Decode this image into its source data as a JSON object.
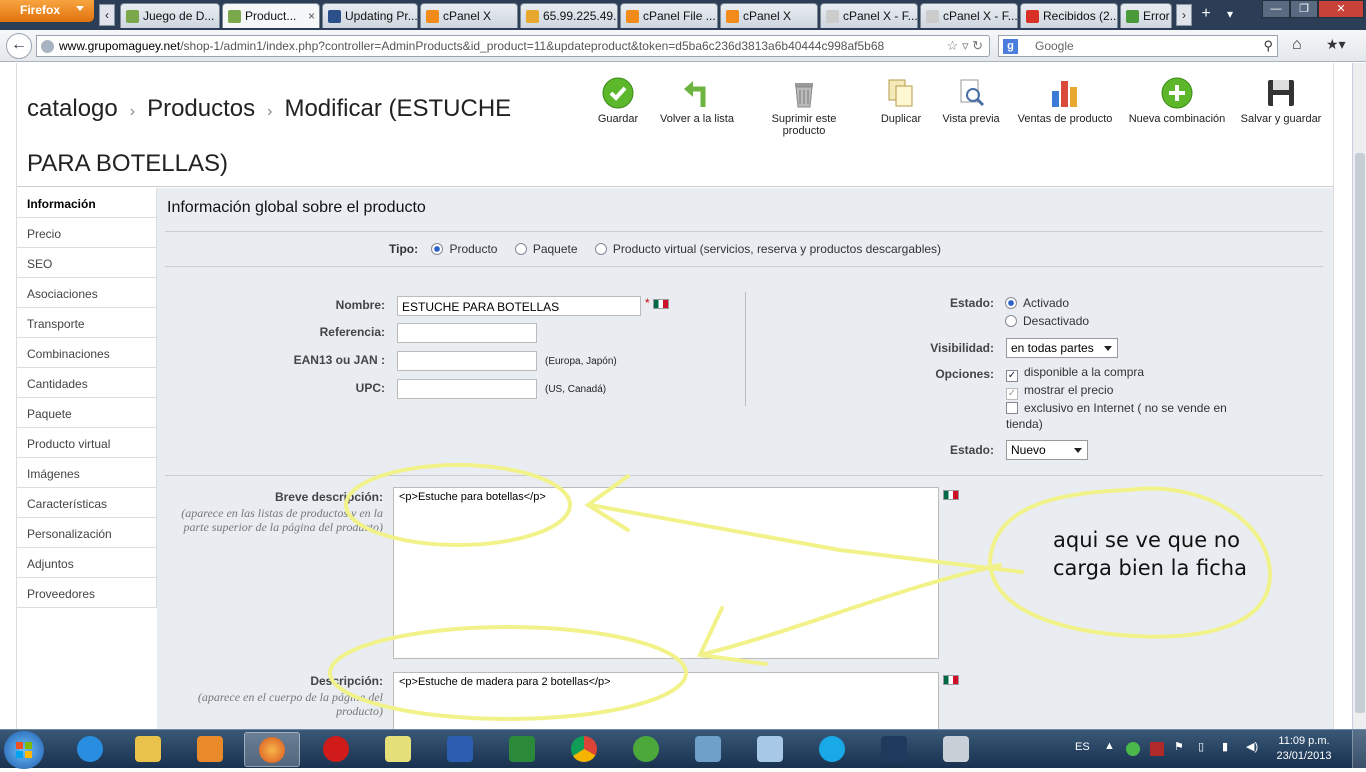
{
  "browser": {
    "app_button": "Firefox",
    "tabs": [
      {
        "label": "Juego de D...",
        "color": "#7aa84a",
        "active": false
      },
      {
        "label": "Product...",
        "color": "#7aa84a",
        "active": true,
        "close": "×"
      },
      {
        "label": "Updating Pr...",
        "color": "#2a4f8a",
        "active": false
      },
      {
        "label": "cPanel X",
        "color": "#f28b1a",
        "active": false
      },
      {
        "label": "65.99.225.49...",
        "color": "#e8a830",
        "active": false
      },
      {
        "label": "cPanel File ...",
        "color": "#f28b1a",
        "active": false
      },
      {
        "label": "cPanel X",
        "color": "#f28b1a",
        "active": false
      },
      {
        "label": "cPanel X - F...",
        "color": "#cccccc",
        "active": false
      },
      {
        "label": "cPanel X - F...",
        "color": "#cccccc",
        "active": false
      },
      {
        "label": "Recibidos (2...",
        "color": "#d93025",
        "active": false
      },
      {
        "label": "Error",
        "color": "#4a9a3a",
        "active": false
      }
    ],
    "url_host": "www.grupomaguey.net",
    "url_path": "/shop-1/admin1/index.php?controller=AdminProducts&id_product=11&updateproduct&token=d5ba6c236d3813a6b40444c998af5b68",
    "search_placeholder": "Google"
  },
  "breadcrumb": {
    "part1": "catalogo",
    "part2": "Productos",
    "part3": "Modificar (ESTUCHE PARA BOTELLAS)",
    "separator": "›"
  },
  "toolbar": {
    "save": "Guardar",
    "back": "Volver a la lista",
    "delete": "Suprimir este producto",
    "duplicate": "Duplicar",
    "preview": "Vista previa",
    "sales": "Ventas de producto",
    "new_combination": "Nueva combinación",
    "save_stay": "Salvar y guardar"
  },
  "sidebar": {
    "items": [
      "Información",
      "Precio",
      "SEO",
      "Asociaciones",
      "Transporte",
      "Combinaciones",
      "Cantidades",
      "Paquete",
      "Producto virtual",
      "Imágenes",
      "Características",
      "Personalización",
      "Adjuntos",
      "Proveedores"
    ]
  },
  "form": {
    "title": "Información global sobre el producto",
    "tipo_label": "Tipo:",
    "tipo_options": [
      "Producto",
      "Paquete",
      "Producto virtual (servicios, reserva y productos descargables)"
    ],
    "nombre_label": "Nombre:",
    "nombre_value": "ESTUCHE PARA BOTELLAS",
    "required_mark": "*",
    "referencia_label": "Referencia:",
    "ean_label": "EAN13 ou JAN :",
    "ean_hint": "(Europa, Japón)",
    "upc_label": "UPC:",
    "upc_hint": "(US, Canadá)",
    "estado_label": "Estado:",
    "estado_on": "Activado",
    "estado_off": "Desactivado",
    "visibilidad_label": "Visibilidad:",
    "visibilidad_value": "en todas partes",
    "opciones_label": "Opciones:",
    "opcion1": "disponible a la compra",
    "opcion2": "mostrar el precio",
    "opcion3": "exclusivo en Internet ( no se vende en tienda)",
    "condicion_label": "Estado:",
    "condicion_value": "Nuevo",
    "breve_label": "Breve descripción:",
    "breve_sub": "(aparece en las listas de productos y en la parte superior de la página del producto)",
    "breve_value": "<p>Estuche para botellas</p>",
    "desc_label": "Descripción:",
    "desc_sub": "(aparece en el cuerpo de la página del producto)",
    "desc_value": "<p>Estuche de madera para 2 botellas</p>"
  },
  "annotation": {
    "note": "aqui se ve que no carga bien la ficha",
    "color": "#f2f28a"
  },
  "taskbar": {
    "language": "ES",
    "time": "11:09 p.m.",
    "date": "23/01/2013"
  }
}
